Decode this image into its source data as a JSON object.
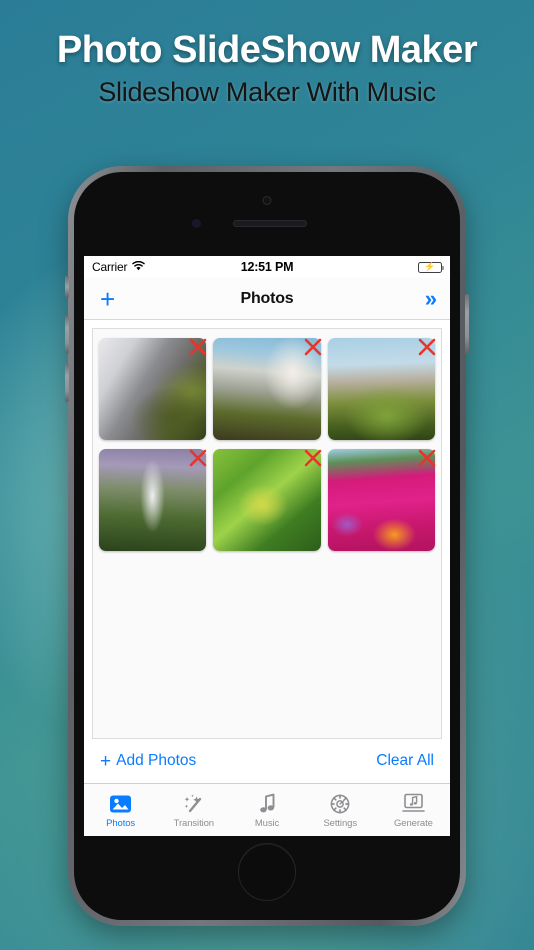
{
  "promo": {
    "title": "Photo SlideShow Maker",
    "subtitle": "Slideshow Maker With Music"
  },
  "colors": {
    "accent_blue": "#0a7cff",
    "delete_red": "#e8342a",
    "battery_green": "#4cd764",
    "inactive_gray": "#8e8e93",
    "background_teal": "#2f8496"
  },
  "status_bar": {
    "carrier": "Carrier",
    "wifi_icon": "wifi-icon",
    "time": "12:51 PM",
    "battery_icon": "battery-charging-icon"
  },
  "nav_bar": {
    "add_icon": "plus-icon",
    "title": "Photos",
    "next_icon": "double-chevron-right-icon"
  },
  "photos": {
    "delete_icon": "close-x-icon",
    "items": [
      {
        "name": "waterfall-over-mossy-rocks",
        "art": "img-waterfall-rocks"
      },
      {
        "name": "large-waterfall-cliff",
        "art": "img-big-falls"
      },
      {
        "name": "beach-grass-flowers",
        "art": "img-beach-grass"
      },
      {
        "name": "tall-waterfall-canyon",
        "art": "img-tall-falls"
      },
      {
        "name": "green-leaves-foliage",
        "art": "img-green-leaves"
      },
      {
        "name": "pink-magenta-flowers",
        "art": "img-pink-flowers"
      }
    ]
  },
  "actions": {
    "add_plus": "+",
    "add_label": "Add Photos",
    "clear_label": "Clear All"
  },
  "tab_bar": {
    "items": [
      {
        "label": "Photos",
        "icon": "photo-image-icon",
        "active": true
      },
      {
        "label": "Transition",
        "icon": "magic-wand-icon",
        "active": false
      },
      {
        "label": "Music",
        "icon": "music-note-icon",
        "active": false
      },
      {
        "label": "Settings",
        "icon": "gear-icon",
        "active": false
      },
      {
        "label": "Generate",
        "icon": "monitor-note-icon",
        "active": false
      }
    ]
  }
}
